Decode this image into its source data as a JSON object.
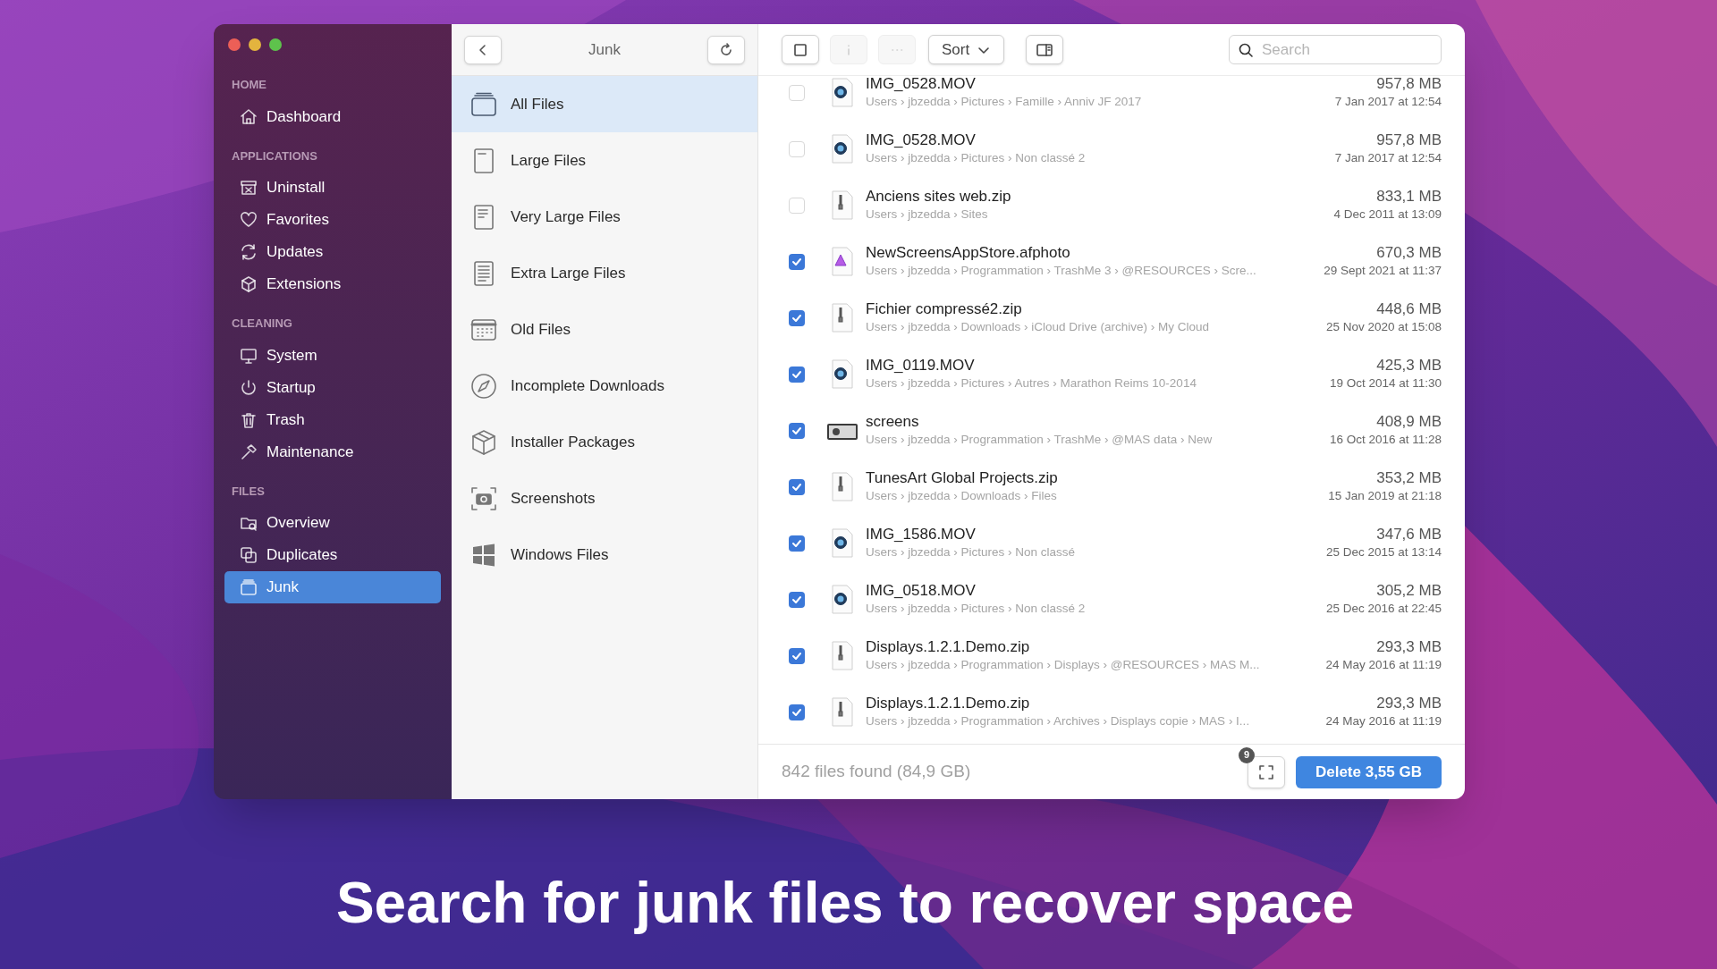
{
  "window": {
    "controls": [
      {
        "color": "#ec5f57"
      },
      {
        "color": "#e3b43e"
      },
      {
        "color": "#5ec24c"
      }
    ]
  },
  "sidebar": {
    "sections": [
      {
        "title": "HOME",
        "items": [
          {
            "label": "Dashboard",
            "selected": false
          }
        ]
      },
      {
        "title": "APPLICATIONS",
        "items": [
          {
            "label": "Uninstall",
            "selected": false
          },
          {
            "label": "Favorites",
            "selected": false
          },
          {
            "label": "Updates",
            "selected": false
          },
          {
            "label": "Extensions",
            "selected": false
          }
        ]
      },
      {
        "title": "CLEANING",
        "items": [
          {
            "label": "System",
            "selected": false
          },
          {
            "label": "Startup",
            "selected": false
          },
          {
            "label": "Trash",
            "selected": false
          },
          {
            "label": "Maintenance",
            "selected": false
          }
        ]
      },
      {
        "title": "FILES",
        "items": [
          {
            "label": "Overview",
            "selected": false
          },
          {
            "label": "Duplicates",
            "selected": false
          },
          {
            "label": "Junk",
            "selected": true
          }
        ]
      }
    ]
  },
  "categories": {
    "title": "Junk",
    "items": [
      {
        "label": "All Files",
        "selected": true
      },
      {
        "label": "Large Files",
        "selected": false
      },
      {
        "label": "Very Large Files",
        "selected": false
      },
      {
        "label": "Extra Large Files",
        "selected": false
      },
      {
        "label": "Old Files",
        "selected": false
      },
      {
        "label": "Incomplete Downloads",
        "selected": false
      },
      {
        "label": "Installer Packages",
        "selected": false
      },
      {
        "label": "Screenshots",
        "selected": false
      },
      {
        "label": "Windows Files",
        "selected": false
      }
    ]
  },
  "toolbar": {
    "buttons": [
      {
        "kind": "select",
        "disabled": false
      },
      {
        "kind": "info",
        "disabled": true
      },
      {
        "kind": "more",
        "disabled": true
      },
      {
        "kind": "sort",
        "label": "Sort",
        "disabled": false
      },
      {
        "kind": "panel",
        "disabled": false
      }
    ],
    "search": {
      "placeholder": "Search"
    }
  },
  "files": [
    {
      "kind": "movie",
      "checked": false,
      "name": "IMG_0528.MOV",
      "path": "Users › jbzedda › Pictures › Famille › Anniv JF 2017",
      "size": "957,8 MB",
      "date": "7 Jan 2017 at 12:54"
    },
    {
      "kind": "movie",
      "checked": false,
      "name": "IMG_0528.MOV",
      "path": "Users › jbzedda › Pictures › Non classé 2",
      "size": "957,8 MB",
      "date": "7 Jan 2017 at 12:54"
    },
    {
      "kind": "zip",
      "checked": false,
      "name": "Anciens sites web.zip",
      "path": "Users › jbzedda › Sites",
      "size": "833,1 MB",
      "date": "4 Dec 2011 at 13:09"
    },
    {
      "checked": true,
      "name": "NewScreensAppStore.afphoto",
      "path": "Users › jbzedda › Programmation › TrashMe 3 › @RESOURCES › Scre...",
      "size": "670,3 MB",
      "date": "29 Sept 2021 at 11:37"
    },
    {
      "kind": "zip",
      "checked": true,
      "name": "Fichier compressé2.zip",
      "path": "Users › jbzedda › Downloads › iCloud Drive (archive) › My Cloud",
      "size": "448,6 MB",
      "date": "25 Nov 2020 at 15:08"
    },
    {
      "kind": "movie",
      "checked": true,
      "name": "IMG_0119.MOV",
      "path": "Users › jbzedda › Pictures › Autres › Marathon Reims 10-2014",
      "size": "425,3 MB",
      "date": "19 Oct 2014 at 11:30"
    },
    {
      "kind": "folder",
      "checked": true,
      "name": "screens",
      "path": "Users › jbzedda › Programmation › TrashMe › @MAS data › New",
      "size": "408,9 MB",
      "date": "16 Oct 2016 at 11:28"
    },
    {
      "kind": "zip",
      "checked": true,
      "name": "TunesArt Global Projects.zip",
      "path": "Users › jbzedda › Downloads › Files",
      "size": "353,2 MB",
      "date": "15 Jan 2019 at 21:18"
    },
    {
      "kind": "movie",
      "checked": true,
      "name": "IMG_1586.MOV",
      "path": "Users › jbzedda › Pictures › Non classé",
      "size": "347,6 MB",
      "date": "25 Dec 2015 at 13:14"
    },
    {
      "kind": "movie",
      "checked": true,
      "name": "IMG_0518.MOV",
      "path": "Users › jbzedda › Pictures › Non classé 2",
      "size": "305,2 MB",
      "date": "25 Dec 2016 at 22:45"
    },
    {
      "kind": "zip",
      "checked": true,
      "name": "Displays.1.2.1.Demo.zip",
      "path": "Users › jbzedda › Programmation › Displays › @RESOURCES › MAS M...",
      "size": "293,3 MB",
      "date": "24 May 2016 at 11:19"
    },
    {
      "kind": "zip",
      "checked": true,
      "name": "Displays.1.2.1.Demo.zip",
      "path": "Users › jbzedda › Programmation › Archives › Displays copie › MAS › I...",
      "size": "293,3 MB",
      "date": "24 May 2016 at 11:19"
    }
  ],
  "footer": {
    "summary": "842 files found (84,9 GB)",
    "badge": "9",
    "delete_label": "Delete 3,55 GB"
  },
  "caption": "Search for junk files to recover space"
}
